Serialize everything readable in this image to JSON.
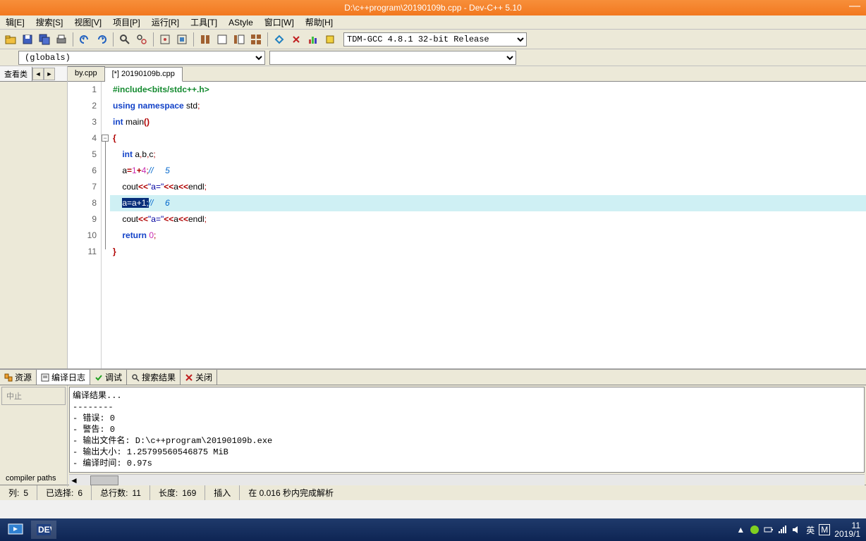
{
  "title": "D:\\c++program\\20190109b.cpp - Dev-C++ 5.10",
  "menu": [
    "辑[E]",
    "搜索[S]",
    "视图[V]",
    "项目[P]",
    "运行[R]",
    "工具[T]",
    "AStyle",
    "窗口[W]",
    "帮助[H]"
  ],
  "compiler_selected": "TDM-GCC 4.8.1 32-bit Release",
  "scope_selected": "(globals)",
  "left_panel": {
    "tab": "查看类",
    "nav_left": "◄",
    "nav_right": "►"
  },
  "file_tabs": [
    {
      "label": "by.cpp",
      "active": false
    },
    {
      "label": "[*] 20190109b.cpp",
      "active": true
    }
  ],
  "code": {
    "lines": [
      {
        "n": "1",
        "tokens": [
          [
            "pre",
            "#include<bits/stdc++.h>"
          ]
        ]
      },
      {
        "n": "2",
        "tokens": [
          [
            "kw",
            "using"
          ],
          [
            "id",
            " "
          ],
          [
            "kw",
            "namespace"
          ],
          [
            "id",
            " std"
          ],
          [
            "pun",
            ";"
          ]
        ]
      },
      {
        "n": "3",
        "tokens": [
          [
            "kw",
            "int"
          ],
          [
            "id",
            " main"
          ],
          [
            "op",
            "()"
          ]
        ]
      },
      {
        "n": "4",
        "tokens": [
          [
            "op",
            "{"
          ]
        ],
        "fold": true
      },
      {
        "n": "5",
        "tokens": [
          [
            "id",
            "    "
          ],
          [
            "kw",
            "int"
          ],
          [
            "id",
            " a"
          ],
          [
            "pun",
            ","
          ],
          [
            "id",
            "b"
          ],
          [
            "pun",
            ","
          ],
          [
            "id",
            "c"
          ],
          [
            "pun",
            ";"
          ]
        ]
      },
      {
        "n": "6",
        "tokens": [
          [
            "id",
            "    a"
          ],
          [
            "op",
            "="
          ],
          [
            "num",
            "1"
          ],
          [
            "op",
            "+"
          ],
          [
            "num",
            "4"
          ],
          [
            "pun",
            ";"
          ],
          [
            "com",
            "//     5"
          ]
        ]
      },
      {
        "n": "7",
        "tokens": [
          [
            "id",
            "    cout"
          ],
          [
            "op",
            "<<"
          ],
          [
            "str",
            "\"a=\""
          ],
          [
            "op",
            "<<"
          ],
          [
            "id",
            "a"
          ],
          [
            "op",
            "<<"
          ],
          [
            "id",
            "endl"
          ],
          [
            "pun",
            ";"
          ]
        ]
      },
      {
        "n": "8",
        "tokens": [
          [
            "id",
            "    "
          ],
          [
            "sel",
            "a=a+1;"
          ],
          [
            "com",
            "//     6"
          ]
        ],
        "current": true
      },
      {
        "n": "9",
        "tokens": [
          [
            "id",
            "    cout"
          ],
          [
            "op",
            "<<"
          ],
          [
            "str",
            "\"a=\""
          ],
          [
            "op",
            "<<"
          ],
          [
            "id",
            "a"
          ],
          [
            "op",
            "<<"
          ],
          [
            "id",
            "endl"
          ],
          [
            "pun",
            ";"
          ]
        ]
      },
      {
        "n": "10",
        "tokens": [
          [
            "id",
            "    "
          ],
          [
            "kw",
            "return"
          ],
          [
            "id",
            " "
          ],
          [
            "num",
            "0"
          ],
          [
            "pun",
            ";"
          ]
        ]
      },
      {
        "n": "11",
        "tokens": [
          [
            "op",
            "}"
          ]
        ]
      }
    ]
  },
  "bottom_tabs": [
    {
      "icon": "copy",
      "label": "资源"
    },
    {
      "icon": "log",
      "label": "编译日志",
      "active": true
    },
    {
      "icon": "check",
      "label": "调试"
    },
    {
      "icon": "search",
      "label": "搜索结果"
    },
    {
      "icon": "close",
      "label": "关闭"
    }
  ],
  "bottom_left": {
    "abort": "中止",
    "paths": "compiler paths"
  },
  "output_text": "编译结果...\n--------\n- 错误: 0\n- 警告: 0\n- 输出文件名: D:\\c++program\\20190109b.exe\n- 输出大小: 1.25799560546875 MiB\n- 编译时间: 0.97s",
  "status": {
    "col_label": "列:",
    "col_val": "5",
    "sel_label": "已选择:",
    "sel_val": "6",
    "lines_label": "总行数:",
    "lines_val": "11",
    "len_label": "长度:",
    "len_val": "169",
    "mode": "插入",
    "parse": "在 0.016 秒内完成解析"
  },
  "taskbar": {
    "time": "11",
    "date": "2019/1",
    "ime1": "英",
    "ime2": "M"
  }
}
